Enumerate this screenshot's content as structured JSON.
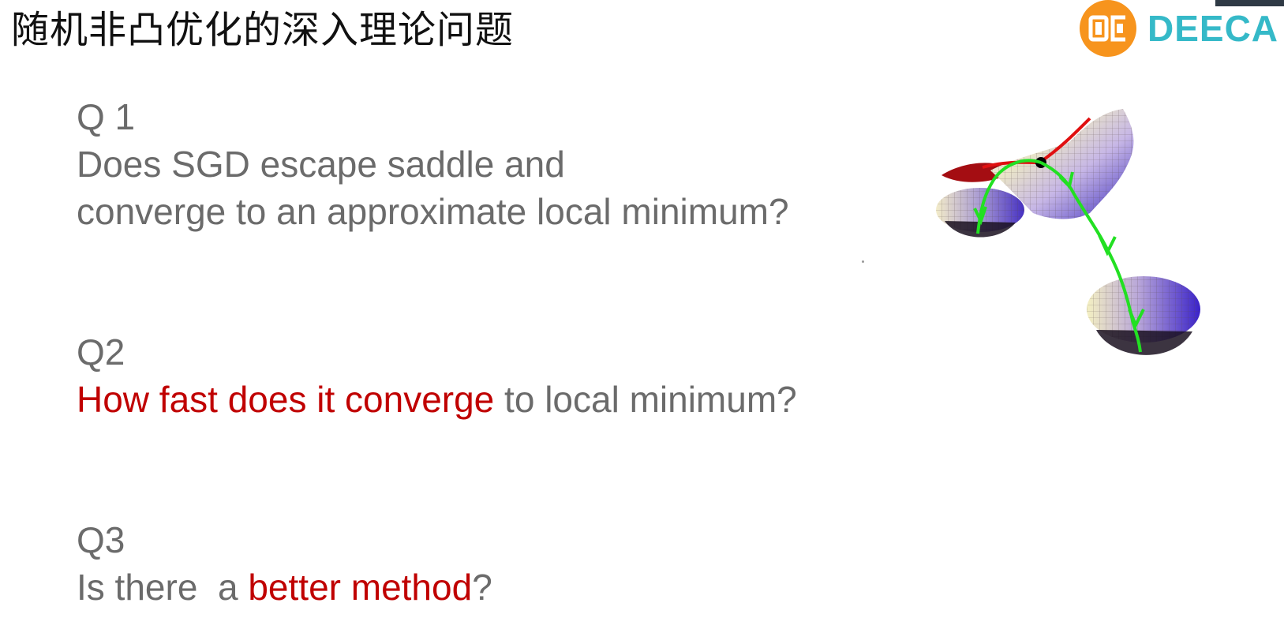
{
  "slide": {
    "title": "随机非凸优化的深入理论问题",
    "logo": {
      "text": "DEECA",
      "mark": "dc-logo-icon",
      "colors": {
        "circle": "#f7941d",
        "text": "#35b9c8"
      }
    },
    "questions": [
      {
        "label": "Q 1",
        "lines": [
          [
            {
              "text": "Does SGD escape saddle and",
              "highlight": false
            }
          ],
          [
            {
              "text": "converge to an approximate local minimum?",
              "highlight": false
            }
          ]
        ]
      },
      {
        "label": "Q2",
        "lines": [
          [
            {
              "text": "How fast does it converge",
              "highlight": true
            },
            {
              "text": " to local minimum?",
              "highlight": false
            }
          ]
        ]
      },
      {
        "label": "Q3",
        "lines": [
          [
            {
              "text": "Is there  a ",
              "highlight": false
            },
            {
              "text": "better method",
              "highlight": true
            },
            {
              "text": "?",
              "highlight": false
            }
          ]
        ]
      }
    ],
    "colors": {
      "body_text": "#6b6b6b",
      "highlight": "#c00000",
      "title": "#111111"
    },
    "illustration": {
      "icon": "saddle-to-minima-surface-illustration"
    }
  }
}
